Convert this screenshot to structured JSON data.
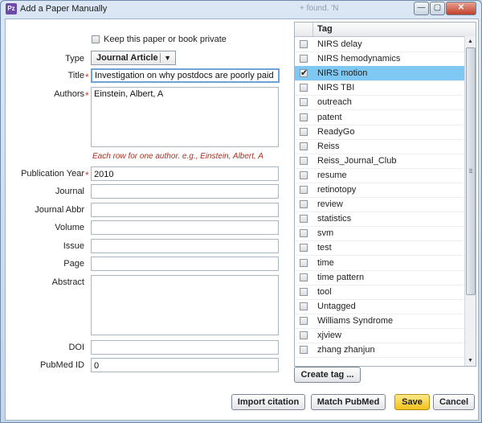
{
  "window": {
    "title": "Add a Paper Manually",
    "ghost_title": "+ found. 'N",
    "app_icon": "Pz",
    "controls": {
      "minimize": "—",
      "maximize": "▢",
      "close": "✕"
    }
  },
  "form": {
    "private_label": "Keep this paper or book private",
    "private_checked": false,
    "type": {
      "label": "Type",
      "value": "Journal Article"
    },
    "title": {
      "label": "Title",
      "value": "Investigation on why postdocs are poorly paid",
      "required": "*"
    },
    "authors": {
      "label": "Authors",
      "value": "Einstein, Albert, A",
      "required": "*"
    },
    "authors_hint": "Each row for one author. e.g., Einstein, Albert, A",
    "year": {
      "label": "Publication Year",
      "value": "2010",
      "required": "*"
    },
    "journal": {
      "label": "Journal",
      "value": ""
    },
    "journal_abbr": {
      "label": "Journal Abbr",
      "value": ""
    },
    "volume": {
      "label": "Volume",
      "value": ""
    },
    "issue": {
      "label": "Issue",
      "value": ""
    },
    "page": {
      "label": "Page",
      "value": ""
    },
    "abstract": {
      "label": "Abstract",
      "value": ""
    },
    "doi": {
      "label": "DOI",
      "value": ""
    },
    "pubmed_id": {
      "label": "PubMed ID",
      "value": "0"
    }
  },
  "tags": {
    "header": "Tag",
    "items": [
      {
        "name": "NIRS delay",
        "checked": false
      },
      {
        "name": "NIRS hemodynamics",
        "checked": false
      },
      {
        "name": "NIRS motion",
        "checked": true
      },
      {
        "name": "NIRS TBI",
        "checked": false
      },
      {
        "name": "outreach",
        "checked": false
      },
      {
        "name": "patent",
        "checked": false
      },
      {
        "name": "ReadyGo",
        "checked": false
      },
      {
        "name": "Reiss",
        "checked": false
      },
      {
        "name": "Reiss_Journal_Club",
        "checked": false
      },
      {
        "name": "resume",
        "checked": false
      },
      {
        "name": "retinotopy",
        "checked": false
      },
      {
        "name": "review",
        "checked": false
      },
      {
        "name": "statistics",
        "checked": false
      },
      {
        "name": "svm",
        "checked": false
      },
      {
        "name": "test",
        "checked": false
      },
      {
        "name": "time",
        "checked": false
      },
      {
        "name": "time pattern",
        "checked": false
      },
      {
        "name": "tool",
        "checked": false
      },
      {
        "name": "Untagged",
        "checked": false
      },
      {
        "name": "Williams Syndrome",
        "checked": false
      },
      {
        "name": "xjview",
        "checked": false
      },
      {
        "name": "zhang zhanjun",
        "checked": false
      }
    ],
    "create_label": "Create tag ..."
  },
  "buttons": {
    "import": "Import citation",
    "match": "Match PubMed",
    "save": "Save",
    "cancel": "Cancel"
  },
  "colors": {
    "selected_row": "#7ec8f4",
    "required_star": "#d23b2c",
    "hint_text": "#a8301f",
    "save_button": "#f2c21a"
  }
}
